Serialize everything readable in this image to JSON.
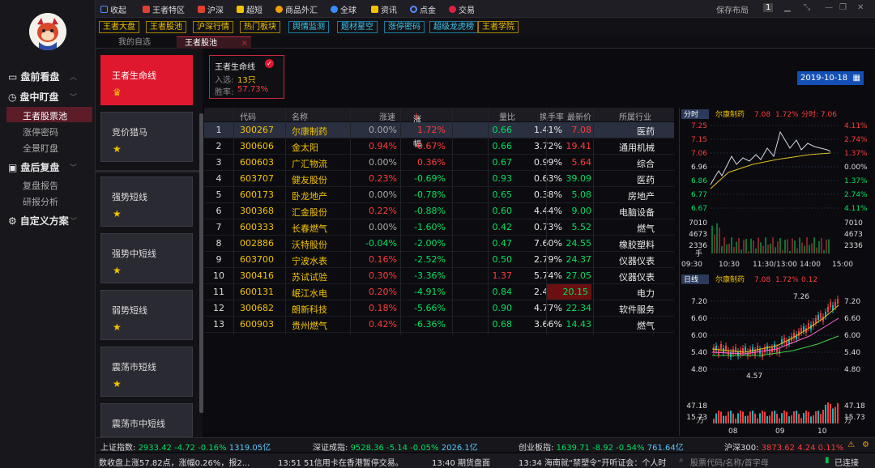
{
  "sidebar": {
    "items": [
      {
        "label": "盘前看盘"
      },
      {
        "label": "盘中盯盘"
      },
      {
        "label": "王者股票池"
      },
      {
        "label": "涨停密码"
      },
      {
        "label": "全景盯盘"
      },
      {
        "label": "盘后复盘"
      },
      {
        "label": "复盘报告"
      },
      {
        "label": "研报分析"
      },
      {
        "label": "自定义方案"
      }
    ]
  },
  "topbar": {
    "collapse": "收起",
    "items": [
      "王者特区",
      "沪深",
      "超短",
      "商品外汇",
      "全球",
      "资讯",
      "点金",
      "交易"
    ],
    "save_layout": "保存布局",
    "layout_num": "1"
  },
  "toolbar2": [
    "王者大盘",
    "王者股池",
    "沪深行情",
    "热门板块",
    "舆情监测",
    "题材星空",
    "涨停密码",
    "超级龙虎榜",
    "王者学院"
  ],
  "tabs": {
    "watchlist": "我的自选",
    "pool": "王者股池"
  },
  "cards": [
    "王者生命线",
    "竞价猎马",
    "强势短线",
    "强势中短线",
    "弱势短线",
    "震荡市短线",
    "震荡市中短线"
  ],
  "info": {
    "title": "王者生命线",
    "in_label": "入选:",
    "in_value": "13只",
    "win_label": "胜率:",
    "win_value": "57.73%"
  },
  "date": "2019-10-18",
  "table": {
    "headers": [
      "代码",
      "名称",
      "涨速",
      "涨跌幅",
      "量比",
      "换手率",
      "最新价",
      "所属行业"
    ],
    "rows": [
      [
        "1",
        "300267",
        "尔康制药",
        "0.00%",
        "1.72%",
        "0.66",
        "1.41%",
        "7.08",
        "医药"
      ],
      [
        "2",
        "300606",
        "金太阳",
        "0.94%",
        "0.67%",
        "0.66",
        "3.72%",
        "19.41",
        "通用机械"
      ],
      [
        "3",
        "600603",
        "广汇物流",
        "0.00%",
        "0.36%",
        "0.67",
        "0.99%",
        "5.64",
        "综合"
      ],
      [
        "4",
        "603707",
        "健友股份",
        "0.23%",
        "-0.69%",
        "0.93",
        "0.63%",
        "39.09",
        "医药"
      ],
      [
        "5",
        "600173",
        "卧龙地产",
        "0.00%",
        "-0.78%",
        "0.65",
        "0.38%",
        "5.08",
        "房地产"
      ],
      [
        "6",
        "300368",
        "汇金股份",
        "0.22%",
        "-0.88%",
        "0.60",
        "4.44%",
        "9.00",
        "电脑设备"
      ],
      [
        "7",
        "600333",
        "长春燃气",
        "0.00%",
        "-1.60%",
        "0.42",
        "0.73%",
        "5.52",
        "燃气"
      ],
      [
        "8",
        "002886",
        "沃特股份",
        "-0.04%",
        "-2.00%",
        "0.47",
        "7.60%",
        "24.55",
        "橡胶塑料"
      ],
      [
        "9",
        "603700",
        "宁波水表",
        "0.16%",
        "-2.52%",
        "0.50",
        "2.79%",
        "24.37",
        "仪器仪表"
      ],
      [
        "10",
        "300416",
        "苏试试验",
        "0.30%",
        "-3.36%",
        "1.37",
        "5.74%",
        "27.05",
        "仪器仪表"
      ],
      [
        "11",
        "600131",
        "岷江水电",
        "0.20%",
        "-4.91%",
        "0.84",
        "2.47%",
        "20.15",
        "电力"
      ],
      [
        "12",
        "300682",
        "朗新科技",
        "0.18%",
        "-5.66%",
        "0.90",
        "4.77%",
        "22.34",
        "软件服务"
      ],
      [
        "13",
        "600903",
        "贵州燃气",
        "0.42%",
        "-6.36%",
        "0.68",
        "3.66%",
        "14.43",
        "燃气"
      ]
    ]
  },
  "minute_chart": {
    "tab": "分时",
    "name": "尔康制药",
    "price": "7.08",
    "pct": "1.72%",
    "avg": "分时: 7.06",
    "left_axis": [
      "7.25",
      "7.15",
      "7.06",
      "6.96",
      "6.86",
      "6.77",
      "6.67"
    ],
    "right_axis": [
      "4.11%",
      "2.74%",
      "1.37%",
      "0.00%",
      "1.37%",
      "2.74%",
      "4.11%"
    ],
    "vol_axis": [
      "7010",
      "4673",
      "2336",
      "手"
    ],
    "time_axis": [
      "09:30",
      "10:30",
      "11:30/13:00",
      "14:00",
      "15:00"
    ]
  },
  "daily_chart": {
    "tab": "日线",
    "name": "尔康制药",
    "price": "7.08",
    "pct": "1.72%",
    "chg": "0.12",
    "price_axis": [
      "7.20",
      "6.60",
      "6.00",
      "5.40",
      "4.80"
    ],
    "high_label": "7.26",
    "low_label": "4.57",
    "vol_axis": [
      "47.18",
      "15.73",
      "万"
    ],
    "date_axis": [
      "08",
      "09",
      "10"
    ]
  },
  "status": [
    {
      "name": "上证指数:",
      "value": "2933.42",
      "chg": "-4.72",
      "pct": "-0.16%",
      "amt": "1319.05亿"
    },
    {
      "name": "深证成指:",
      "value": "9528.36",
      "chg": "-5.14",
      "pct": "-0.05%",
      "amt": "2026.1亿"
    },
    {
      "name": "创业板指:",
      "value": "1639.71",
      "chg": "-8.92",
      "pct": "-0.54%",
      "amt": "761.64亿"
    },
    {
      "name": "沪深300:",
      "value": "3873.62",
      "chg": "4.24",
      "pct": "0.11%"
    }
  ],
  "news": [
    "数收盘上涨57.82点，涨幅0.26%，报2...",
    "13:51 51信用卡在香港暂停交易。",
    "13:40 期货盘面",
    "13:34 海南就“禁塑令”开听证会：个人时",
    "股票代码/名称/首字母",
    "已连接"
  ],
  "colors": {
    "accent_red": "#e0182d",
    "up": "#ff3b3b",
    "down": "#00e060",
    "gold": "#f2c200"
  }
}
